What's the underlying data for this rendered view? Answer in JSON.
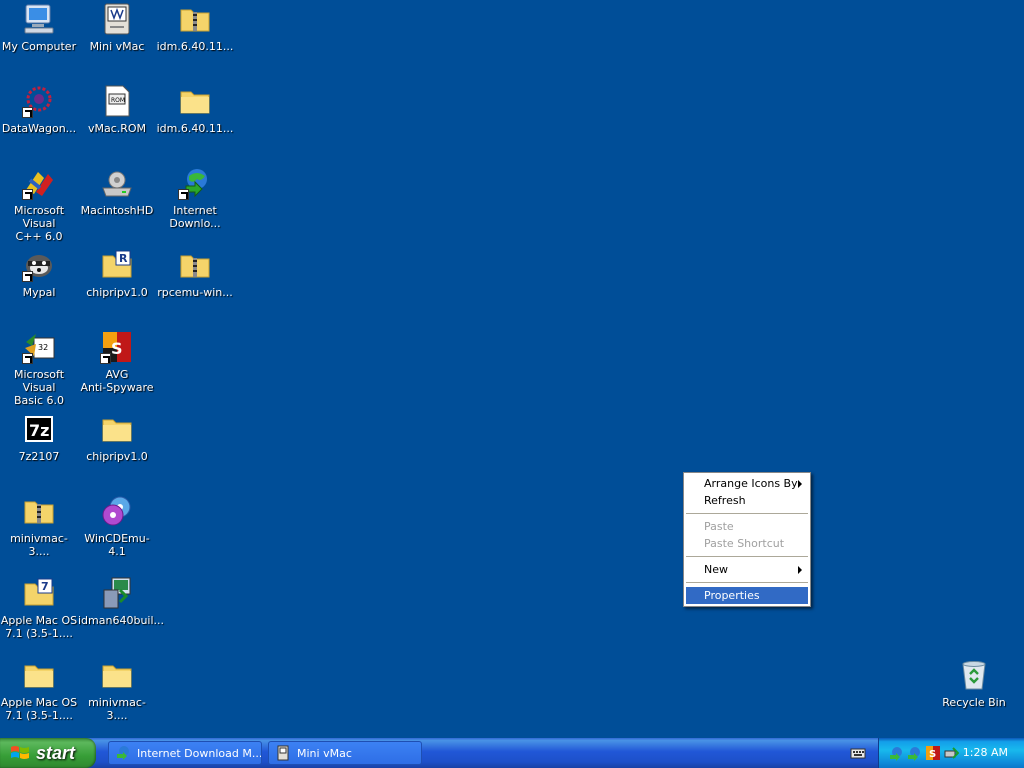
{
  "desktop": {
    "icons": [
      {
        "label": "My Computer",
        "icon": "my-computer-icon"
      },
      {
        "label": "Mini vMac",
        "icon": "mini-vmac-icon"
      },
      {
        "label": "idm.6.40.11...",
        "icon": "zip-folder-icon"
      },
      {
        "label": "DataWagon...",
        "icon": "datawagon-icon"
      },
      {
        "label": "vMac.ROM",
        "icon": "rom-file-icon"
      },
      {
        "label": "idm.6.40.11...",
        "icon": "folder-icon"
      },
      {
        "label": "Microsoft Visual\nC++ 6.0",
        "icon": "visual-cpp-icon"
      },
      {
        "label": "MacintoshHD",
        "icon": "disk-drive-icon"
      },
      {
        "label": "Internet\nDownlo...",
        "icon": "internet-download-manager-icon"
      },
      {
        "label": "Mypal",
        "icon": "mypal-icon"
      },
      {
        "label": "chipripv1.0",
        "icon": "winrar-folder-icon"
      },
      {
        "label": "rpcemu-win...",
        "icon": "zip-folder-icon"
      },
      {
        "label": "Microsoft Visual\nBasic 6.0",
        "icon": "visual-basic-icon"
      },
      {
        "label": "AVG\nAnti-Spyware",
        "icon": "avg-antispyware-icon"
      },
      {
        "label": "7z2107",
        "icon": "7zip-icon"
      },
      {
        "label": "chipripv1.0",
        "icon": "folder-icon"
      },
      {
        "label": "minivmac-3....",
        "icon": "zip-folder-icon"
      },
      {
        "label": "WinCDEmu-4.1",
        "icon": "wincdemu-icon"
      },
      {
        "label": "Apple Mac OS\n7.1 (3.5-1....",
        "icon": "7zip-folder-icon"
      },
      {
        "label": "idman640buil...",
        "icon": "installer-icon"
      },
      {
        "label": "Apple Mac OS\n7.1 (3.5-1....",
        "icon": "folder-icon"
      },
      {
        "label": "minivmac-3....",
        "icon": "folder-icon"
      },
      {
        "label": "Recycle Bin",
        "icon": "recycle-bin-icon"
      }
    ]
  },
  "context_menu": {
    "arrange_icons_by": "Arrange Icons By",
    "refresh": "Refresh",
    "paste": "Paste",
    "paste_shortcut": "Paste Shortcut",
    "new": "New",
    "properties": "Properties"
  },
  "taskbar": {
    "start_label": "start",
    "tasks": [
      {
        "label": "Internet Download M...",
        "icon": "internet-download-manager-icon"
      },
      {
        "label": "Mini vMac",
        "icon": "mini-vmac-icon"
      }
    ],
    "clock": "1:28 AM"
  },
  "colors": {
    "desktop_background": "#004e98",
    "taskbar_blue": "#245edb",
    "start_green": "#3c9a3c",
    "menu_highlight": "#316ac5"
  }
}
